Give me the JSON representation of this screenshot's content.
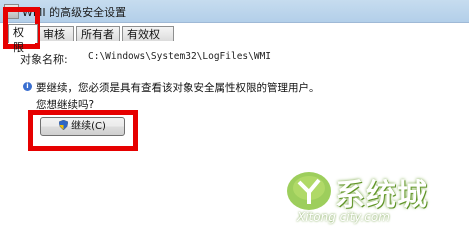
{
  "window": {
    "title": "WMI 的高级安全设置"
  },
  "tabs": [
    {
      "label": "权限"
    },
    {
      "label": "审核"
    },
    {
      "label": "所有者"
    },
    {
      "label": "有效权限"
    }
  ],
  "object": {
    "label": "对象名称:",
    "value": "C:\\Windows\\System32\\LogFiles\\WMI"
  },
  "notice": {
    "message": "要继续，您必须是具有查看该对象安全属性权限的管理用户。",
    "question": "您想继续吗?"
  },
  "continue_button": {
    "label": "继续(C)"
  },
  "watermark": {
    "main": "系统城",
    "sub": "Xitong city.com"
  },
  "colors": {
    "annotation": "#e60000",
    "watermark_green": "#6a9e2f"
  }
}
